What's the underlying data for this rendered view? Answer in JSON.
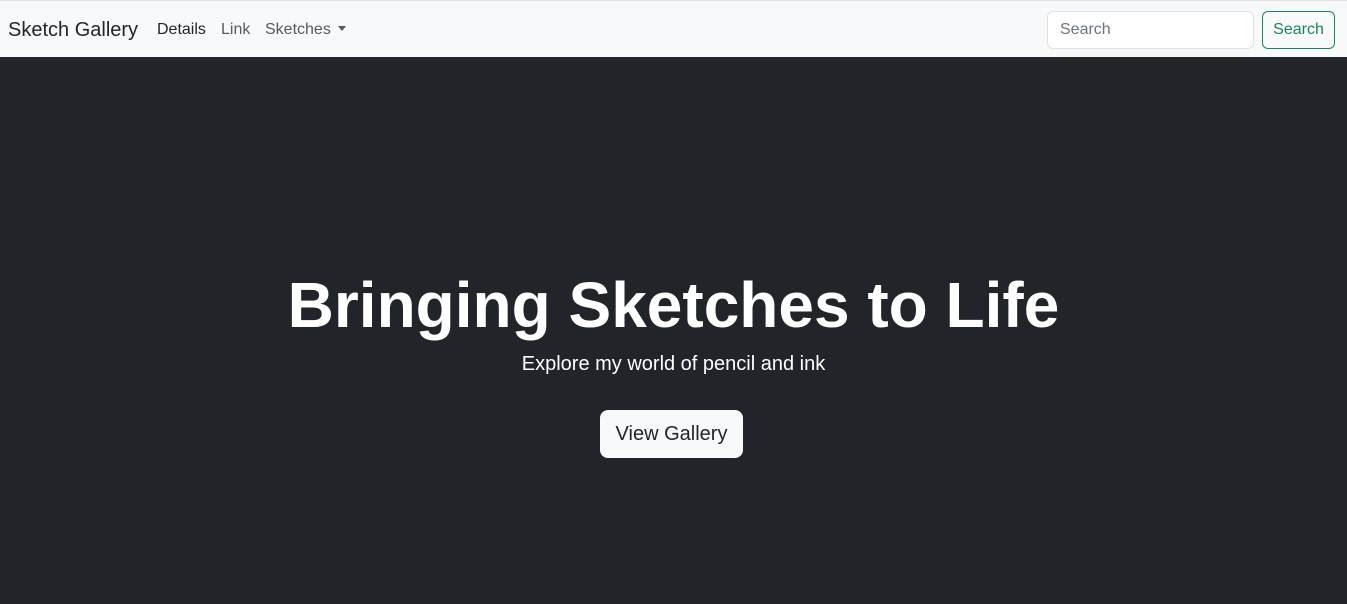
{
  "navbar": {
    "brand": "Sketch Gallery",
    "links": [
      {
        "label": "Details",
        "active": true
      },
      {
        "label": "Link",
        "active": false
      },
      {
        "label": "Sketches",
        "active": false,
        "dropdown": true
      }
    ],
    "search": {
      "value": "",
      "placeholder": "Search",
      "button_label": "Search"
    }
  },
  "hero": {
    "title": "Bringing Sketches to Life",
    "subtitle": "Explore my world of pencil and ink",
    "button_label": "View Gallery"
  },
  "colors": {
    "navbar_bg": "#f8f9fa",
    "hero_bg": "#212529",
    "search_button_accent": "#198754",
    "hero_text": "#ffffff"
  }
}
